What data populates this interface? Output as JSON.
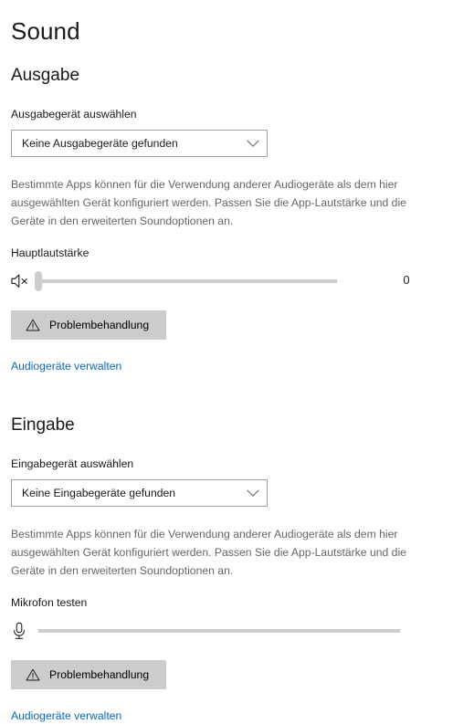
{
  "page": {
    "title": "Sound"
  },
  "output": {
    "section_title": "Ausgabe",
    "device_label": "Ausgabegerät auswählen",
    "device_value": "Keine Ausgabegeräte gefunden",
    "device_chevron_icon": "chevron-down-icon",
    "description": "Bestimmte Apps können für die Verwendung anderer Audiogeräte als dem hier ausgewählten Gerät konfiguriert werden. Passen Sie die App-Lautstärke und die Geräte in den erweiterten Soundoptionen an.",
    "volume_label": "Hauptlautstärke",
    "volume_icon": "speaker-muted-icon",
    "volume_value": "0",
    "volume_percent": 0,
    "troubleshoot_label": "Problembehandlung",
    "troubleshoot_icon": "warning-triangle-icon",
    "manage_devices_link": "Audiogeräte verwalten"
  },
  "input": {
    "section_title": "Eingabe",
    "device_label": "Eingabegerät auswählen",
    "device_value": "Keine Eingabegeräte gefunden",
    "device_chevron_icon": "chevron-down-icon",
    "description": "Bestimmte Apps können für die Verwendung anderer Audiogeräte als dem hier ausgewählten Gerät konfiguriert werden. Passen Sie die App-Lautstärke und die Geräte in den erweiterten Soundoptionen an.",
    "mic_test_label": "Mikrofon testen",
    "mic_icon": "microphone-icon",
    "mic_level_percent": 0,
    "troubleshoot_label": "Problembehandlung",
    "troubleshoot_icon": "warning-triangle-icon",
    "manage_devices_link": "Audiogeräte verwalten"
  },
  "colors": {
    "link": "#0a67bf",
    "button_background": "#cccccc",
    "track": "#cdcdcd",
    "border": "#a3a3a3",
    "text": "#1a1a1a",
    "muted_text": "#666666"
  }
}
